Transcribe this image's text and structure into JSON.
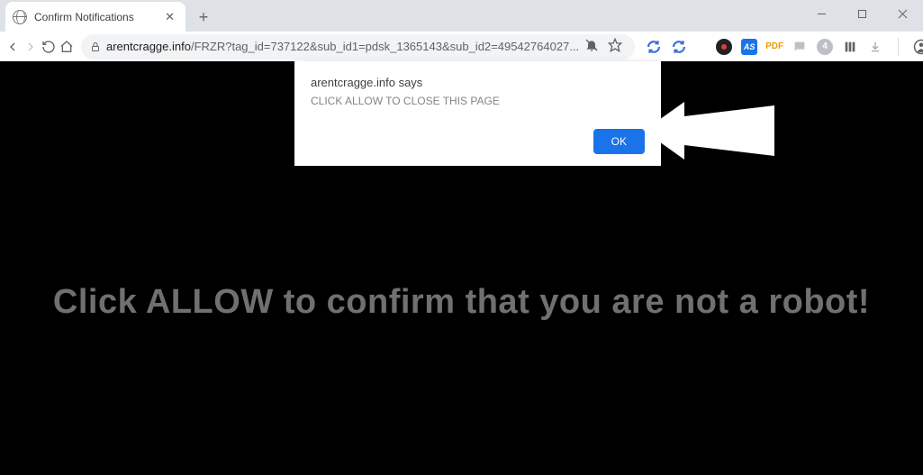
{
  "tab": {
    "title": "Confirm Notifications"
  },
  "omni": {
    "domain": "arentcragge.info",
    "path": "/FRZR?tag_id=737122&sub_id1=pdsk_1365143&sub_id2=49542764027..."
  },
  "ext": {
    "pdf_label": "PDF"
  },
  "dialog": {
    "origin": "arentcragge.info says",
    "message": "CLICK ALLOW TO CLOSE THIS PAGE",
    "ok_label": "OK"
  },
  "page": {
    "headline": "Click ALLOW to confirm that you are not a robot!"
  }
}
